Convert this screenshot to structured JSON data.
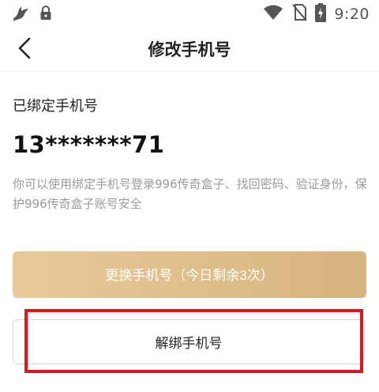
{
  "status_bar": {
    "time": "9:20",
    "left_icons": [
      "bird-icon",
      "lock-icon"
    ],
    "right_icons": [
      "wifi-icon",
      "no-sim-icon",
      "battery-charging-icon"
    ]
  },
  "nav": {
    "title": "修改手机号",
    "back_icon": "chevron-left-icon"
  },
  "main": {
    "bound_label": "已绑定手机号",
    "phone_number": "13*******71",
    "description": "你可以使用绑定手机号登录996传奇盒子、找回密码、验证身份，保护996传奇盒子账号安全",
    "change_button": "更换手机号（今日剩余3次）",
    "unbind_button": "解绑手机号"
  },
  "colors": {
    "accent_gold": "#d7b47e",
    "highlight_red": "#e3141c"
  }
}
